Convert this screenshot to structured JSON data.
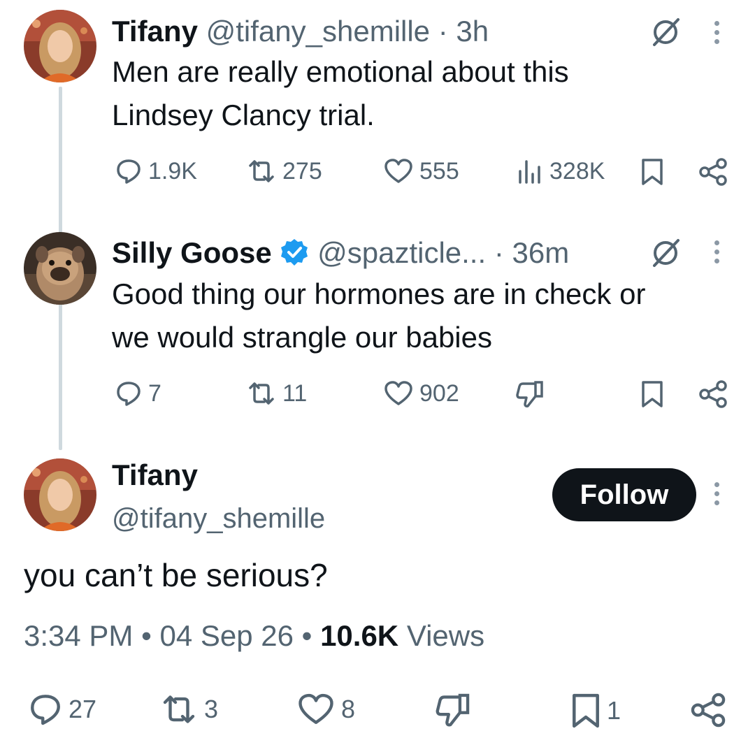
{
  "tweet1": {
    "name": "Tifany",
    "handle": "@tifany_shemille",
    "separator": "·",
    "time": "3h",
    "text_line1": "Men are really emotional about this",
    "text_line2": "Lindsey Clancy trial.",
    "replies": "1.9K",
    "reposts": "275",
    "likes": "555",
    "views": "328K"
  },
  "tweet2": {
    "name": "Silly Goose",
    "handle": "@spazticle...",
    "separator": "·",
    "time": "36m",
    "verified": true,
    "text_line1": "Good thing our hormones are in check or",
    "text_line2": "we would strangle our babies",
    "replies": "7",
    "reposts": "11",
    "likes": "902"
  },
  "main": {
    "name": "Tifany",
    "handle": "@tifany_shemille",
    "follow_label": "Follow",
    "text": "you can’t be serious?",
    "time": "3:34 PM",
    "dot": "•",
    "date": "04 Sep 26",
    "views_count": "10.6K",
    "views_label": "Views",
    "replies": "27",
    "reposts": "3",
    "likes": "8",
    "bookmarks": "1"
  },
  "colors": {
    "text": "#0f1419",
    "muted": "#536471",
    "verified": "#1d9bf0",
    "thread_line": "#cfd9de",
    "button": "#0f1419"
  },
  "icons": [
    "reply-icon",
    "repost-icon",
    "like-icon",
    "views-icon",
    "bookmark-icon",
    "share-icon",
    "grok-icon",
    "more-icon",
    "verified-badge-icon",
    "downvote-icon"
  ]
}
